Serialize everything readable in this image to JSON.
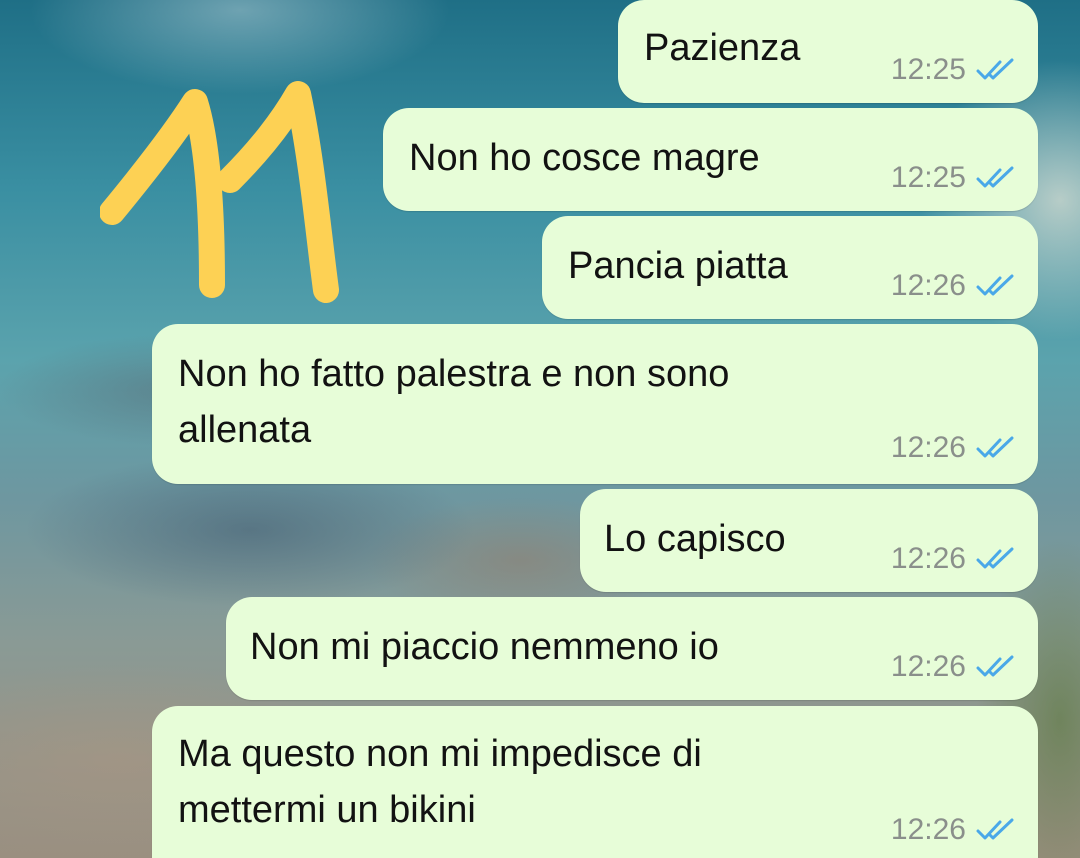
{
  "annotation": {
    "text": "11",
    "color": "#fdd154"
  },
  "theme": {
    "bubble_color": "#e7fdd8",
    "text_color": "#121212",
    "time_color": "#8a8f8b",
    "read_tick_color": "#4aa8e8"
  },
  "messages": [
    {
      "text": "Pazienza",
      "time": "12:25",
      "status": "read-double-tick-icon"
    },
    {
      "text": "Non ho cosce magre",
      "time": "12:25",
      "status": "read-double-tick-icon"
    },
    {
      "text": "Pancia piatta",
      "time": "12:26",
      "status": "read-double-tick-icon"
    },
    {
      "text": "Non ho fatto palestra e non sono\nallenata",
      "time": "12:26",
      "status": "read-double-tick-icon"
    },
    {
      "text": "Lo capisco",
      "time": "12:26",
      "status": "read-double-tick-icon"
    },
    {
      "text": "Non mi piaccio nemmeno io",
      "time": "12:26",
      "status": "read-double-tick-icon"
    },
    {
      "text": "Ma questo non mi impedisce di\nmettermi un bikini",
      "time": "12:26",
      "status": "read-double-tick-icon"
    }
  ]
}
